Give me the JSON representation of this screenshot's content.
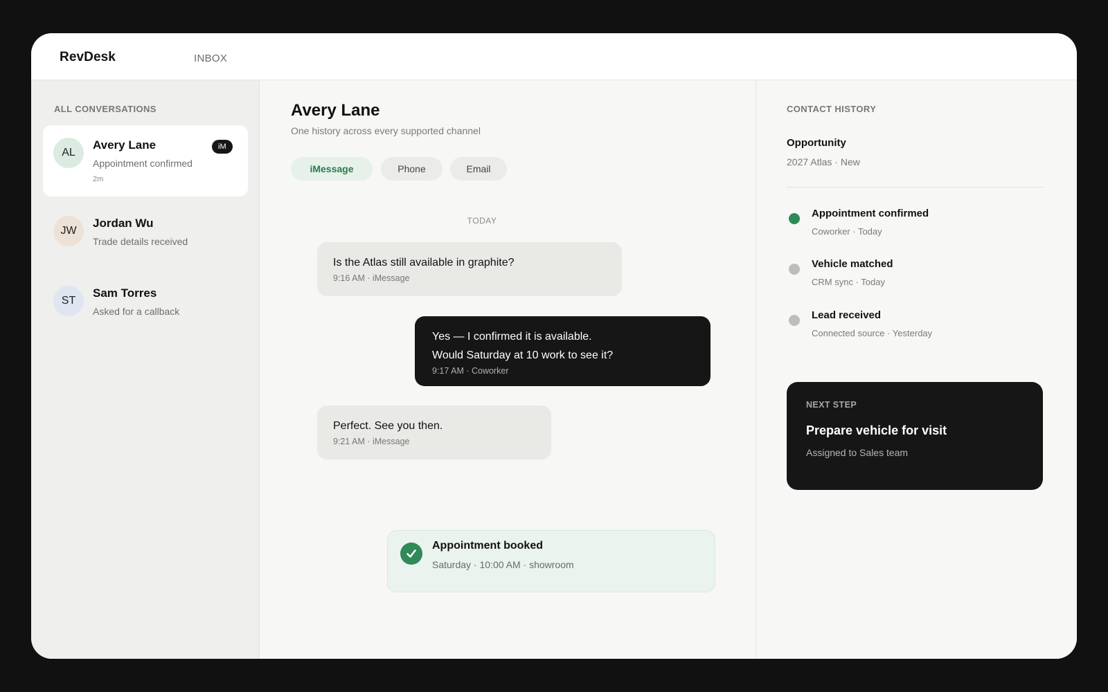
{
  "app": {
    "brand": "RevDesk",
    "nav_inbox": "INBOX"
  },
  "sidebar": {
    "title": "ALL CONVERSATIONS",
    "conversations": [
      {
        "initials": "AL",
        "name": "Avery Lane",
        "preview": "Appointment confirmed",
        "time": "2m",
        "badge": "iM",
        "avatar_color": "#dcebe2"
      },
      {
        "initials": "JW",
        "name": "Jordan Wu",
        "preview": "Trade details received",
        "avatar_color": "#ede2d7"
      },
      {
        "initials": "ST",
        "name": "Sam Torres",
        "preview": "Asked for a callback",
        "avatar_color": "#dfe5f1"
      }
    ]
  },
  "main": {
    "contact_name": "Avery Lane",
    "contact_subtitle": "One history across every supported channel",
    "channels": [
      "iMessage",
      "Phone",
      "Email"
    ],
    "day_label": "TODAY",
    "messages": [
      {
        "direction": "in",
        "lines": [
          "Is the Atlas still available in graphite?"
        ],
        "meta": "9:16 AM · iMessage"
      },
      {
        "direction": "out",
        "lines": [
          "Yes — I confirmed it is available.",
          "Would Saturday at 10 work to see it?"
        ],
        "meta": "9:17 AM · Coworker"
      },
      {
        "direction": "in",
        "lines": [
          "Perfect. See you then."
        ],
        "meta": "9:21 AM · iMessage"
      }
    ],
    "booked": {
      "title": "Appointment booked",
      "subtitle": "Saturday · 10:00 AM · showroom"
    }
  },
  "history": {
    "title": "CONTACT HISTORY",
    "opportunity_label": "Opportunity",
    "opportunity_value": "2027 Atlas · New",
    "events": [
      {
        "title": "Appointment confirmed",
        "sub": "Coworker · Today",
        "status_color": "#2f8a57"
      },
      {
        "title": "Vehicle matched",
        "sub": "CRM sync · Today",
        "status_color": "#bdbdbd"
      },
      {
        "title": "Lead received",
        "sub": "Connected source · Yesterday",
        "status_color": "#bdbdbd"
      }
    ],
    "next_step": {
      "label": "NEXT STEP",
      "title": "Prepare vehicle for visit",
      "subtitle": "Assigned to Sales team"
    }
  }
}
